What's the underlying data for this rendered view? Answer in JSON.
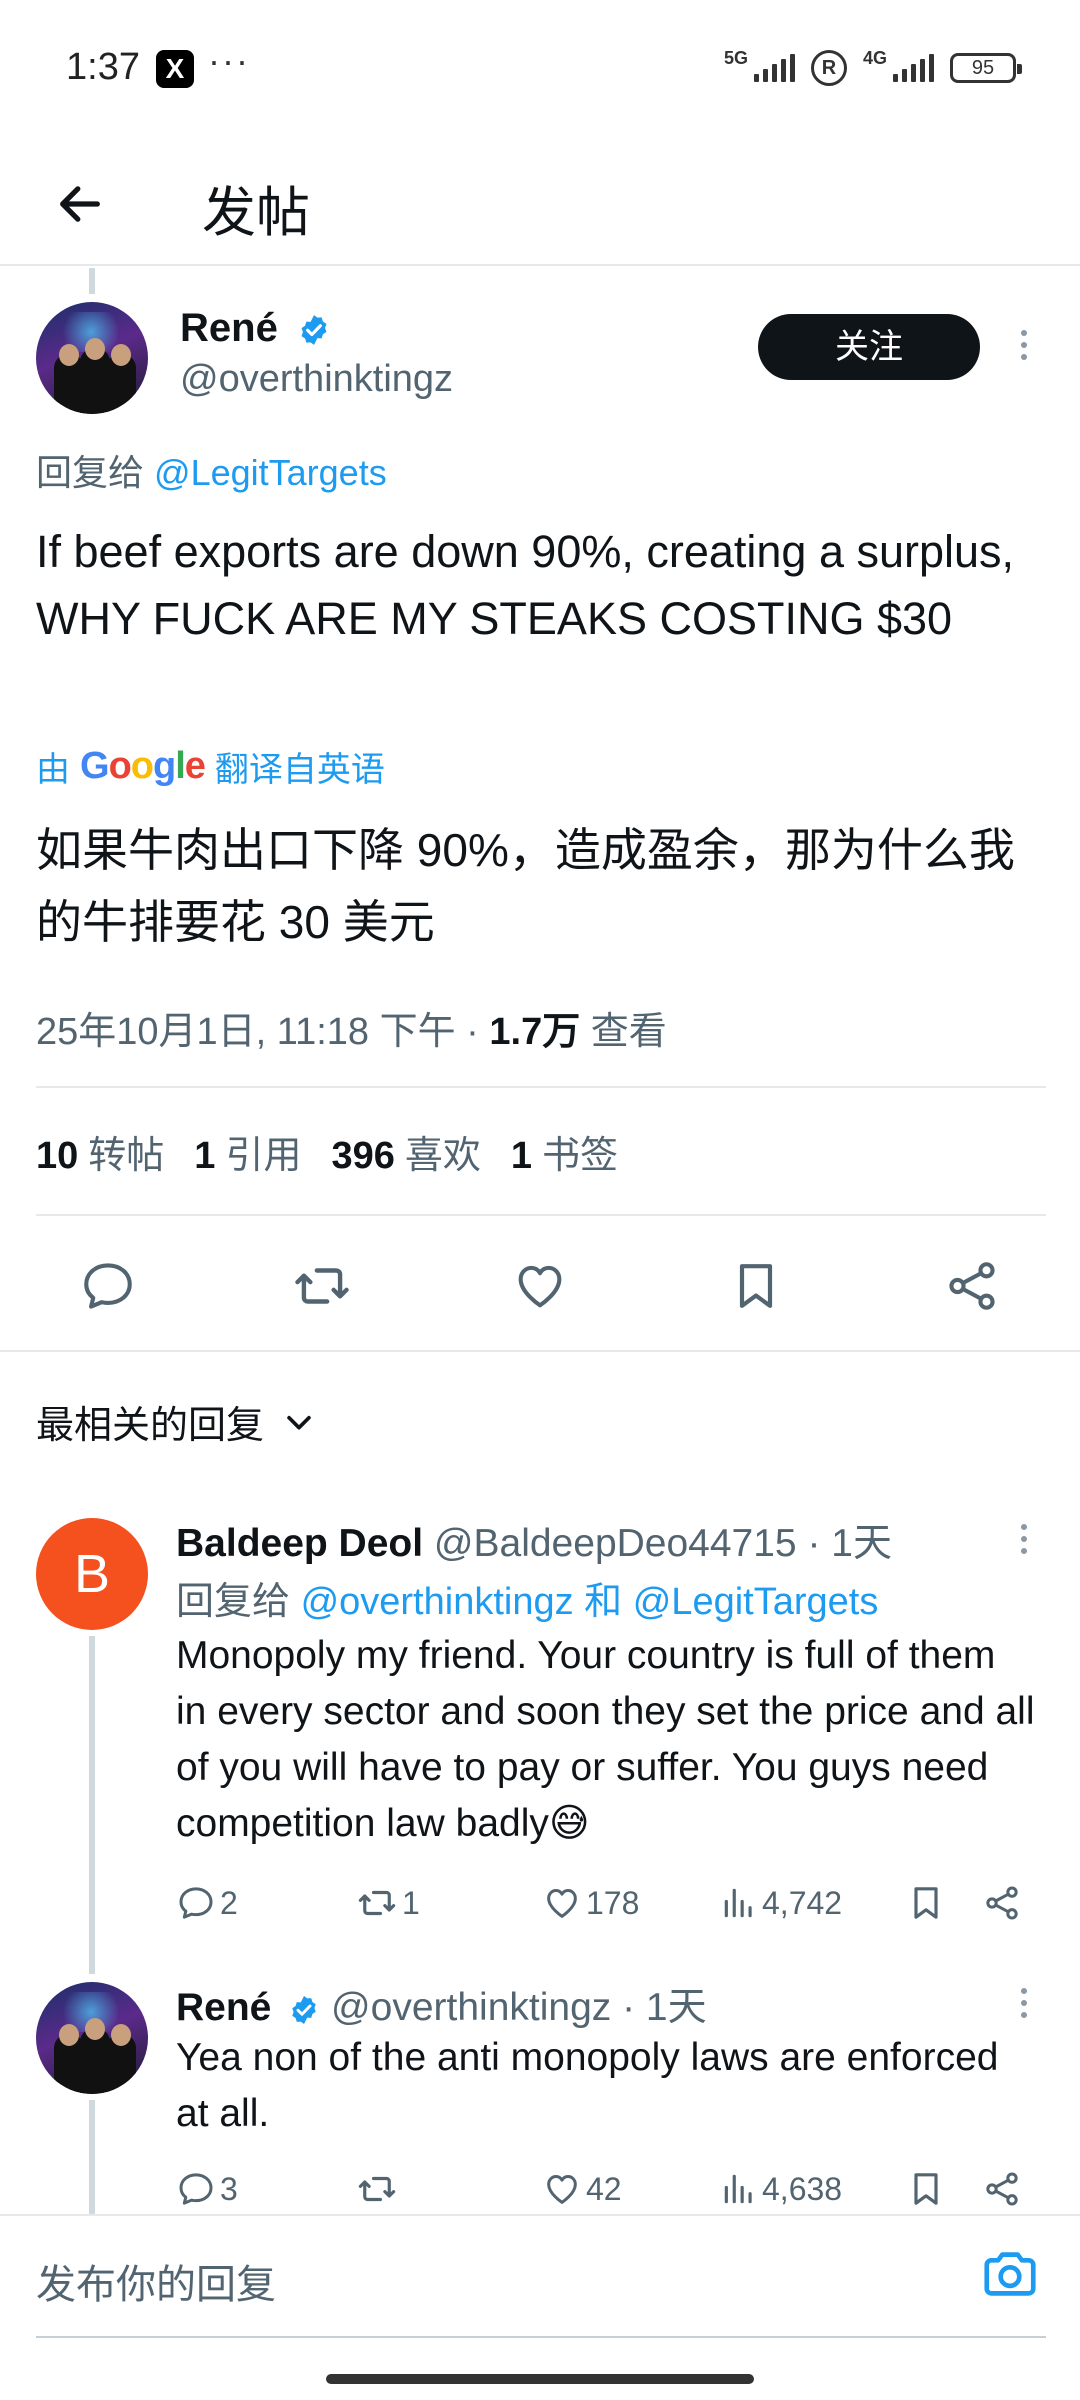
{
  "status_bar": {
    "time": "1:37",
    "app_badge": "X",
    "more": "···",
    "net1": "5G",
    "net2": "4G",
    "reg": "R",
    "battery": "95"
  },
  "header": {
    "title": "发帖"
  },
  "post": {
    "author": "René",
    "handle": "@overthinktingz",
    "follow_label": "关注",
    "reply_to_prefix": "回复给",
    "reply_to_mention": "@LegitTargets",
    "text": "If beef exports are down 90%, creating a surplus, WHY FUCK ARE MY STEAKS COSTING $30",
    "translate_prefix": "由",
    "translate_brand": "Google",
    "translate_suffix": "翻译自英语",
    "translated_text": "如果牛肉出口下降 90%，造成盈余，那为什么我的牛排要花 30 美元",
    "timestamp": "25年10月1日, 11:18 下午 · ",
    "views_count": "1.7万",
    "views_label": " 查看"
  },
  "stats": {
    "reposts_count": "10",
    "reposts_label": "转帖",
    "quotes_count": "1",
    "quotes_label": "引用",
    "likes_count": "396",
    "likes_label": "喜欢",
    "bookmarks_count": "1",
    "bookmarks_label": "书签"
  },
  "sort": {
    "label": "最相关的回复"
  },
  "replies": [
    {
      "avatar_letter": "B",
      "name": "Baldeep Deol",
      "meta": " @BaldeepDeo44715 · 1天",
      "reply_prefix": "回复给 ",
      "mention1": "@overthinktingz",
      "and_word": " 和 ",
      "mention2": "@LegitTargets",
      "text": "Monopoly my friend. Your country is full of them in every sector and soon they set the price and all of you will have to pay or suffer. You guys need competition law badly😅",
      "replies": "2",
      "reposts": "1",
      "likes": "178",
      "views": "4,742"
    },
    {
      "name": "René",
      "meta": " @overthinktingz · 1天",
      "text": "Yea non of the anti monopoly laws are enforced at all.",
      "replies": "3",
      "reposts": "",
      "likes": "42",
      "views": "4,638"
    }
  ],
  "composer": {
    "placeholder": "发布你的回复"
  }
}
